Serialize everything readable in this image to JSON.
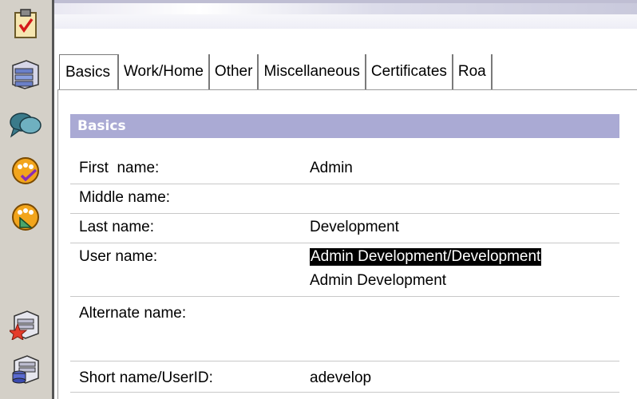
{
  "rail": {
    "icons": [
      {
        "name": "clipboard-check-icon"
      },
      {
        "name": "drawer-stack-icon"
      },
      {
        "name": "chat-bubbles-icon"
      },
      {
        "name": "people-check-icon"
      },
      {
        "name": "people-ruler-icon"
      },
      {
        "name": "drawer-star-icon"
      },
      {
        "name": "drawer-database-icon"
      }
    ]
  },
  "tabs": [
    {
      "label": "Basics"
    },
    {
      "label": "Work/Home"
    },
    {
      "label": "Other"
    },
    {
      "label": "Miscellaneous"
    },
    {
      "label": "Certificates"
    },
    {
      "label": "Roa"
    }
  ],
  "section": {
    "title": "Basics",
    "rows": [
      {
        "label": "First  name:",
        "value": "Admin"
      },
      {
        "label": "Middle name:",
        "value": ""
      },
      {
        "label": "Last name:",
        "value": "Development"
      },
      {
        "label": "User name:",
        "value": "Admin Development/Development",
        "value2": "Admin Development"
      },
      {
        "label": "Alternate name:",
        "value": ""
      },
      {
        "label": "Short name/UserID:",
        "value": "adevelop"
      }
    ]
  },
  "colors": {
    "rail_bg": "#d4d0c8",
    "section_header_bg": "#aaaad4",
    "selection_bg": "#000000"
  }
}
